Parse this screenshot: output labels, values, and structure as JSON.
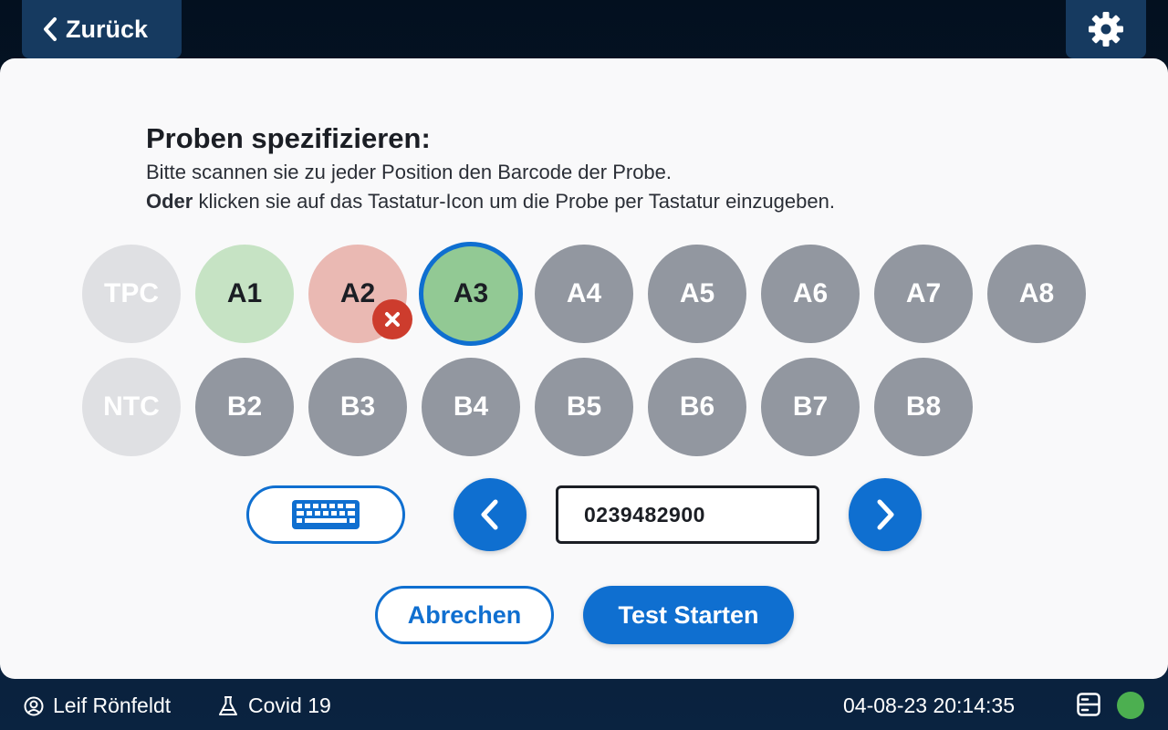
{
  "header": {
    "back_label": "Zurück",
    "back_icon": "chevron-left-icon",
    "settings_icon": "gear-icon"
  },
  "main": {
    "title": "Proben spezifizieren:",
    "instruction_line1": "Bitte scannen sie zu jeder Position den Barcode der Probe.",
    "instruction_line2_bold": "Oder",
    "instruction_line2_rest": " klicken sie auf das Tastatur-Icon um die Probe per Tastatur einzugeben."
  },
  "samples": {
    "row1": [
      {
        "label": "TPC",
        "state": "control"
      },
      {
        "label": "A1",
        "state": "done"
      },
      {
        "label": "A2",
        "state": "error"
      },
      {
        "label": "A3",
        "state": "active"
      },
      {
        "label": "A4",
        "state": "pending"
      },
      {
        "label": "A5",
        "state": "pending"
      },
      {
        "label": "A6",
        "state": "pending"
      },
      {
        "label": "A7",
        "state": "pending"
      },
      {
        "label": "A8",
        "state": "pending"
      }
    ],
    "row2": [
      {
        "label": "NTC",
        "state": "control"
      },
      {
        "label": "B2",
        "state": "pending"
      },
      {
        "label": "B3",
        "state": "pending"
      },
      {
        "label": "B4",
        "state": "pending"
      },
      {
        "label": "B5",
        "state": "pending"
      },
      {
        "label": "B6",
        "state": "pending"
      },
      {
        "label": "B7",
        "state": "pending"
      },
      {
        "label": "B8",
        "state": "pending"
      }
    ]
  },
  "controls": {
    "keyboard_icon": "keyboard-icon",
    "prev_icon": "chevron-left-icon",
    "next_icon": "chevron-right-icon",
    "barcode_value": "0239482900"
  },
  "actions": {
    "cancel_label": "Abrechen",
    "start_label": "Test Starten"
  },
  "footer": {
    "user_name": "Leif Rönfeldt",
    "test_name": "Covid 19",
    "datetime": "04-08-23 20:14:35",
    "server_icon": "server-icon",
    "status": "online"
  },
  "colors": {
    "accent": "#0f6fd0",
    "done": "#c6e3c4",
    "active": "#92c994",
    "error": "#eab9b3",
    "error_badge": "#cd3c2d",
    "pending": "#9297a0",
    "control": "#dfe0e3",
    "status_ok": "#4caf50"
  }
}
